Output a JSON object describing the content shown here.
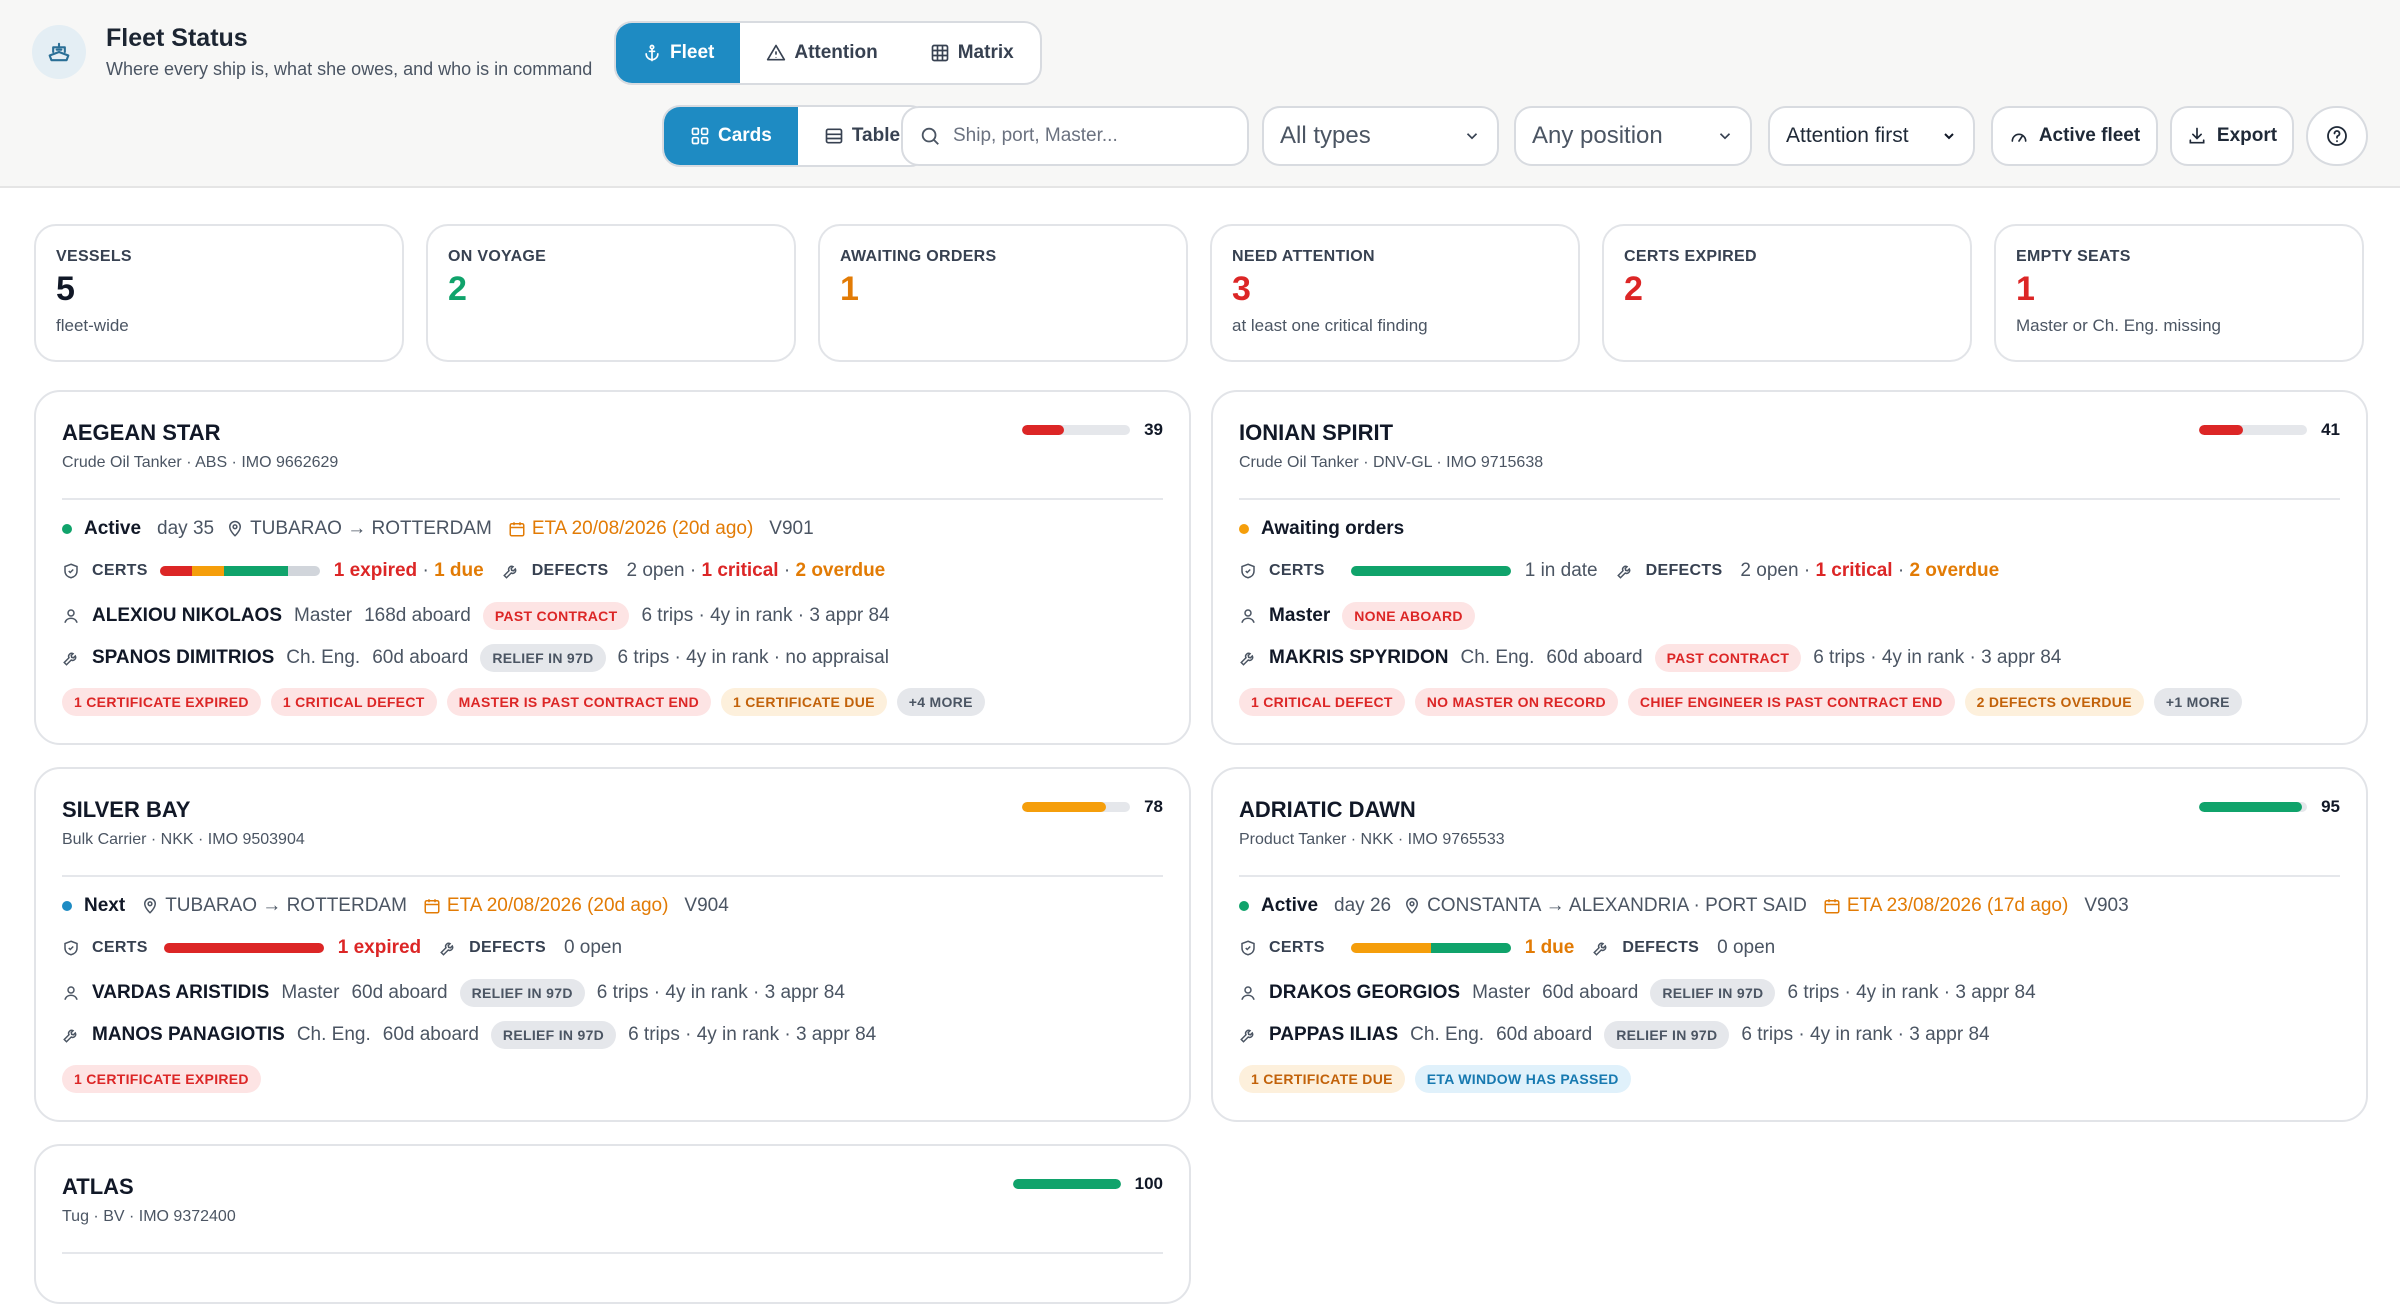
{
  "header": {
    "title": "Fleet Status",
    "subtitle": "Where every ship is, what she owes, and who is in command",
    "nav_tabs": [
      {
        "label": "Fleet",
        "active": true
      },
      {
        "label": "Attention",
        "active": false
      },
      {
        "label": "Matrix",
        "active": false
      }
    ],
    "view_tabs": [
      {
        "label": "Cards",
        "active": true
      },
      {
        "label": "Table",
        "active": false
      }
    ],
    "search_placeholder": "Ship, port, Master...",
    "type_filter": "All types",
    "position_filter": "Any position",
    "sort": "Attention first",
    "active_fleet_label": "Active fleet",
    "export_label": "Export"
  },
  "stats": [
    {
      "label": "VESSELS",
      "value": "5",
      "note": "fleet-wide",
      "color": "#111827"
    },
    {
      "label": "ON VOYAGE",
      "value": "2",
      "note": "",
      "color": "#10a36b"
    },
    {
      "label": "AWAITING ORDERS",
      "value": "1",
      "note": "",
      "color": "#e27b05"
    },
    {
      "label": "NEED ATTENTION",
      "value": "3",
      "note": "at least one critical finding",
      "color": "#dc2626"
    },
    {
      "label": "CERTS EXPIRED",
      "value": "2",
      "note": "",
      "color": "#dc2626"
    },
    {
      "label": "EMPTY SEATS",
      "value": "1",
      "note": "Master or Ch. Eng. missing",
      "color": "#dc2626"
    }
  ],
  "vessels": [
    {
      "name": "AEGEAN STAR",
      "sub": "Crude Oil Tanker · ABS · IMO 9662629",
      "score": "39",
      "status": "Active",
      "status_color": "#10a36b",
      "day": "day 35",
      "route": "TUBARAO → ROTTERDAM",
      "eta": "ETA 20/08/2026 (20d ago)",
      "voyage": "V901",
      "certs_summary_1": "1 expired",
      "certs_sep": " · ",
      "certs_summary_2": "1 due",
      "defects_open": "2 open",
      "defects_sep1": " · ",
      "defects_critical": "1 critical",
      "defects_sep2": " · ",
      "defects_overdue": "2 overdue",
      "master_name": "ALEXIOU NIKOLAOS",
      "master_role": "Master",
      "master_days": "168d aboard",
      "master_tag": "PAST CONTRACT",
      "master_stats": "6 trips · 4y in rank · 3 appr 84",
      "eng_name": "SPANOS DIMITRIOS",
      "eng_role": "Ch. Eng.",
      "eng_days": "60d aboard",
      "eng_tag": "RELIEF IN 97D",
      "eng_stats": "6 trips · 4y in rank · no appraisal",
      "flags": [
        "1 CERTIFICATE EXPIRED",
        "1 CRITICAL DEFECT",
        "MASTER IS PAST CONTRACT END",
        "1 CERTIFICATE DUE",
        "+4 MORE"
      ]
    },
    {
      "name": "IONIAN SPIRIT",
      "sub": "Crude Oil Tanker · DNV-GL · IMO 9715638",
      "score": "41",
      "status": "Awaiting orders",
      "status_color": "#f59e0b",
      "certs_summary_1": "1 in date",
      "defects_open": "2 open",
      "defects_sep1": " · ",
      "defects_critical": "1 critical",
      "defects_sep2": " · ",
      "defects_overdue": "2 overdue",
      "master_role": "Master",
      "master_tag": "NONE ABOARD",
      "eng_name": "MAKRIS SPYRIDON",
      "eng_role": "Ch. Eng.",
      "eng_days": "60d aboard",
      "eng_tag": "PAST CONTRACT",
      "eng_stats": "6 trips · 4y in rank · 3 appr 84",
      "flags": [
        "1 CRITICAL DEFECT",
        "NO MASTER ON RECORD",
        "CHIEF ENGINEER IS PAST CONTRACT END",
        "2 DEFECTS OVERDUE",
        "+1 MORE"
      ]
    },
    {
      "name": "SILVER BAY",
      "sub": "Bulk Carrier · NKK · IMO 9503904",
      "score": "78",
      "status": "Next",
      "status_color": "#1e8bc3",
      "route": "TUBARAO → ROTTERDAM",
      "eta": "ETA 20/08/2026 (20d ago)",
      "voyage": "V904",
      "certs_summary_1": "1 expired",
      "defects_open": "0 open",
      "master_name": "VARDAS ARISTIDIS",
      "master_role": "Master",
      "master_days": "60d aboard",
      "master_tag": "RELIEF IN 97D",
      "master_stats": "6 trips · 4y in rank · 3 appr 84",
      "eng_name": "MANOS PANAGIOTIS",
      "eng_role": "Ch. Eng.",
      "eng_days": "60d aboard",
      "eng_tag": "RELIEF IN 97D",
      "eng_stats": "6 trips · 4y in rank · 3 appr 84",
      "flags": [
        "1 CERTIFICATE EXPIRED"
      ]
    },
    {
      "name": "ADRIATIC DAWN",
      "sub": "Product Tanker · NKK · IMO 9765533",
      "score": "95",
      "status": "Active",
      "status_color": "#10a36b",
      "day": "day 26",
      "route": "CONSTANTA → ALEXANDRIA · PORT SAID",
      "eta": "ETA 23/08/2026 (17d ago)",
      "voyage": "V903",
      "certs_summary_1": "1 due",
      "defects_open": "0 open",
      "master_name": "DRAKOS GEORGIOS",
      "master_role": "Master",
      "master_days": "60d aboard",
      "master_tag": "RELIEF IN 97D",
      "master_stats": "6 trips · 4y in rank · 3 appr 84",
      "eng_name": "PAPPAS ILIAS",
      "eng_role": "Ch. Eng.",
      "eng_days": "60d aboard",
      "eng_tag": "RELIEF IN 97D",
      "eng_stats": "6 trips · 4y in rank · 3 appr 84",
      "flags": [
        "1 CERTIFICATE DUE",
        "ETA WINDOW HAS PASSED"
      ]
    },
    {
      "name": "ATLAS",
      "sub": "Tug · BV · IMO 9372400",
      "score": "100"
    }
  ],
  "labels": {
    "certs": "CERTS",
    "defects": "DEFECTS"
  }
}
